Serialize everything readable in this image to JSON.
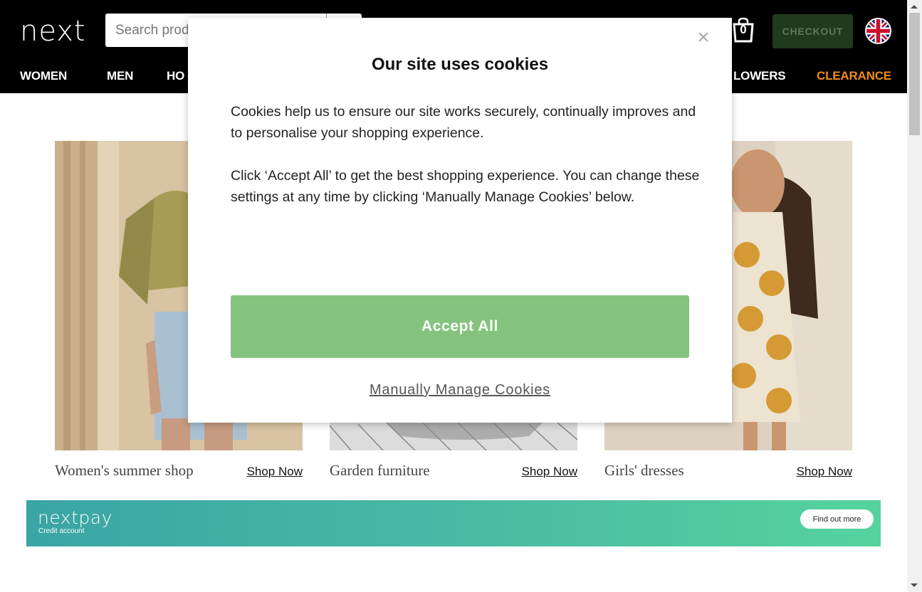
{
  "header": {
    "logo": "next",
    "search_placeholder": "Search product or brand",
    "bag_count": "0",
    "checkout_label": "CHECKOUT",
    "flag_icon": "uk-flag-icon",
    "bag_icon": "shopping-bag-icon"
  },
  "nav": {
    "women": "WOMEN",
    "men": "MEN",
    "home_partial": "HO",
    "flowers_partial": "LOWERS",
    "clearance": "CLEARANCE"
  },
  "cards": [
    {
      "caption": "Women's summer shop",
      "link": "Shop Now"
    },
    {
      "caption": "Garden furniture",
      "link": "Shop Now"
    },
    {
      "caption": "Girls' dresses",
      "link": "Shop Now"
    }
  ],
  "banner": {
    "logo": "nextpay",
    "subtitle": "Credit account",
    "button": "Find out more"
  },
  "modal": {
    "close_symbol": "×",
    "title": "Our site uses cookies",
    "paragraph1": "Cookies help us to ensure our site works securely, continually improves and to personalise your shopping experience.",
    "paragraph2": "Click ‘Accept All’ to get the best shopping experience. You can change these settings at any time by clicking ‘Manually Manage Cookies’ below.",
    "accept_label": "Accept All",
    "manage_label": "Manually Manage Cookies"
  },
  "colors": {
    "header_bg": "#000000",
    "clearance": "#f28c19",
    "checkout_bg": "#1f3a1f",
    "accept_bg": "#84c37e"
  }
}
